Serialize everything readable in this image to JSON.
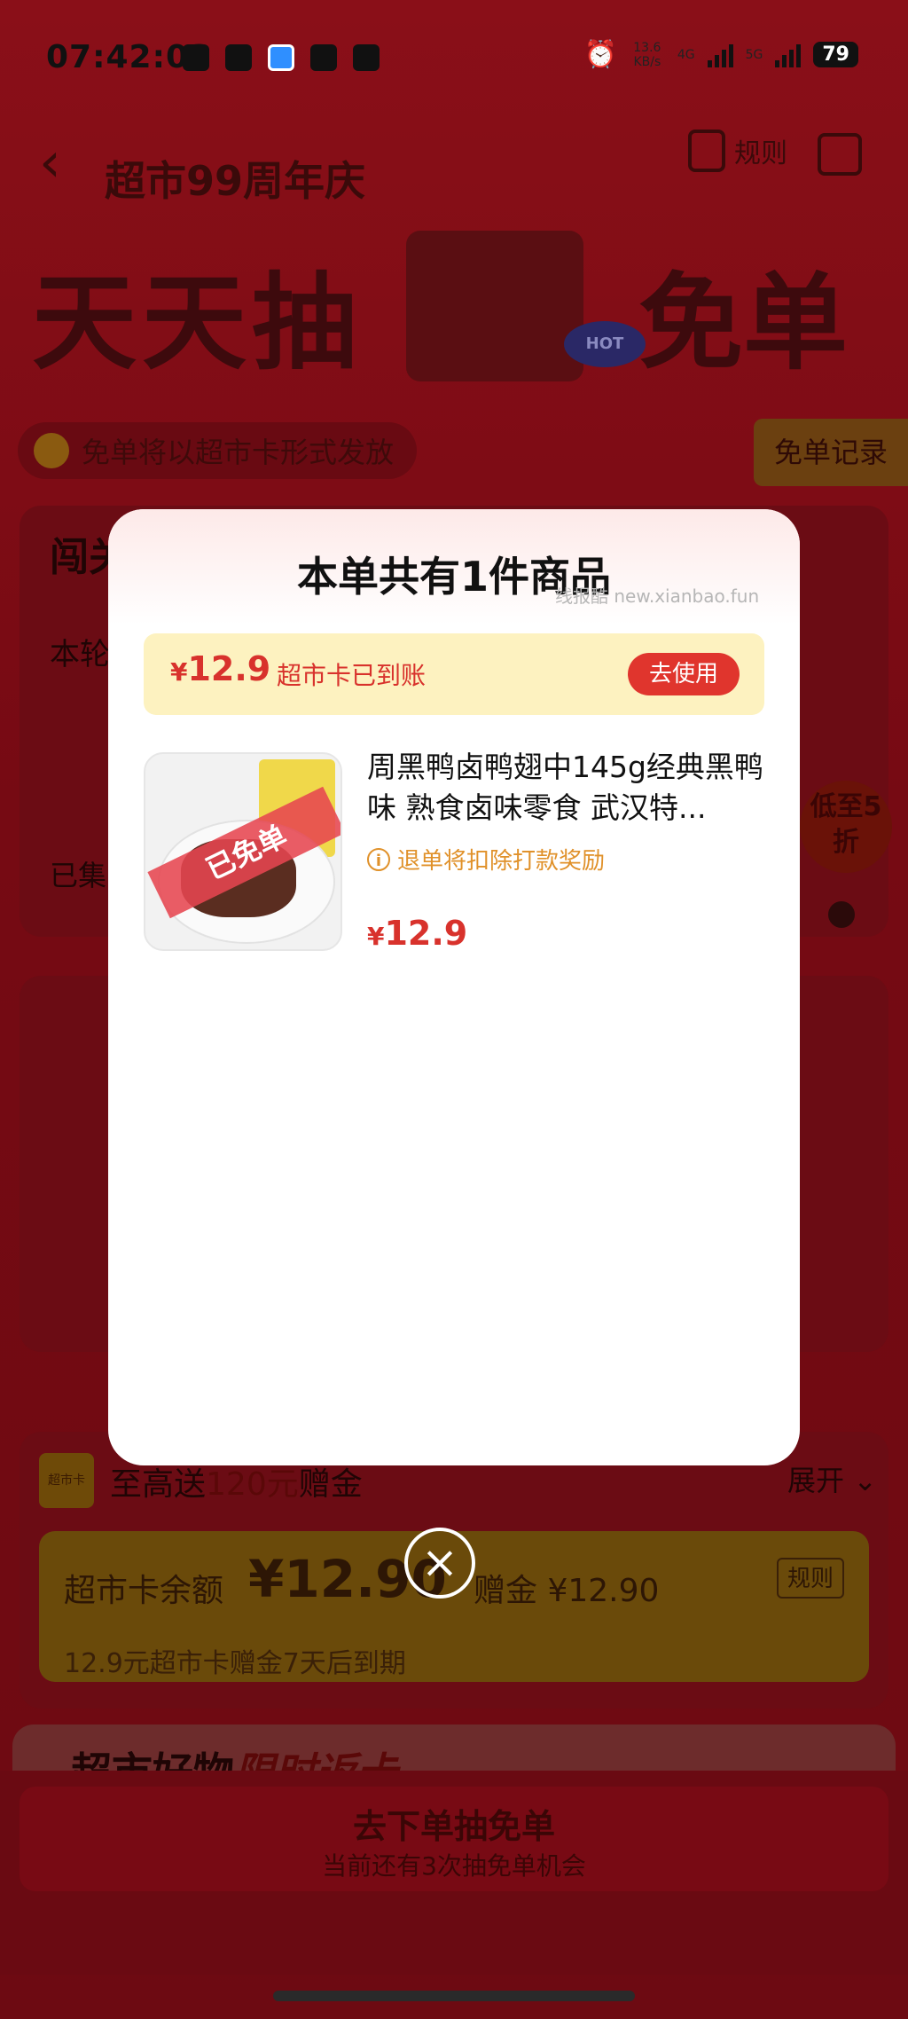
{
  "status_bar": {
    "time": "07:42:03",
    "net_speed": "13.6 KB/s",
    "net_type_1": "4G",
    "net_type_2": "5G",
    "battery": "79"
  },
  "header": {
    "brand_title": "超市99周年庆",
    "rules_label": "规则",
    "hero_text_left": "天天抽",
    "hero_text_right": "免单",
    "hot_badge": "HOT"
  },
  "notice": {
    "text": "免单将以超市卡形式发放",
    "record_button": "免单记录"
  },
  "card1": {
    "title": "闯关",
    "line": "本轮",
    "bottom": "已集",
    "discount": "低至5折"
  },
  "card3": {
    "logo_text": "超市卡",
    "title_prefix": "至高送",
    "title_highlight": "120元",
    "title_suffix": "赠金",
    "expand_label": "展开",
    "balance_label": "超市卡余额",
    "balance_amount": "¥12.90",
    "gift_label": "赠金 ¥12.90",
    "rule_label": "规则",
    "expire_text": "12.9元超市卡赠金7天后到期"
  },
  "card4": {
    "title_prefix": "超市好物",
    "title_highlight": "限时返卡"
  },
  "cta": {
    "main": "去下单抽免单",
    "sub": "当前还有3次抽免单机会"
  },
  "modal": {
    "title": "本单共有1件商品",
    "watermark": "线报酷 new.xianbao.fun",
    "paid_amount": "12.9",
    "currency": "¥",
    "paid_text": "超市卡已到账",
    "use_button": "去使用",
    "product": {
      "name": "周黑鸭卤鸭翅中145g经典黑鸭味 熟食卤味零食 武汉特...",
      "ribbon": "已免单",
      "warning": "退单将扣除打款奖励",
      "price": "12.9"
    },
    "close_icon": "close-icon"
  }
}
